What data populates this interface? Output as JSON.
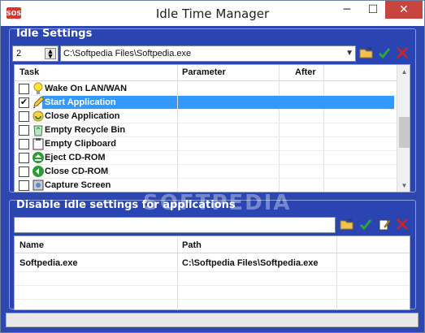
{
  "window": {
    "title": "Idle Time Manager",
    "min": "─",
    "max": "☐",
    "close": "✕"
  },
  "idle_settings": {
    "title": "Idle Settings",
    "spin_value": "2",
    "path_value": "C:\\Softpedia Files\\Softpedia.exe",
    "columns": [
      "Task",
      "Parameter",
      "After"
    ],
    "tasks": [
      {
        "label": "Wake On LAN/WAN",
        "checked": false,
        "icon": "lightbulb-icon",
        "selected": false
      },
      {
        "label": "Start Application",
        "checked": true,
        "icon": "pencil-icon",
        "selected": true
      },
      {
        "label": "Close Application",
        "checked": false,
        "icon": "close-app-icon",
        "selected": false
      },
      {
        "label": "Empty Recycle Bin",
        "checked": false,
        "icon": "recycle-bin-icon",
        "selected": false
      },
      {
        "label": "Empty Clipboard",
        "checked": false,
        "icon": "clipboard-icon",
        "selected": false
      },
      {
        "label": "Eject CD-ROM",
        "checked": false,
        "icon": "eject-icon",
        "selected": false
      },
      {
        "label": "Close CD-ROM",
        "checked": false,
        "icon": "close-cdrom-icon",
        "selected": false
      },
      {
        "label": "Capture Screen",
        "checked": false,
        "icon": "camera-icon",
        "selected": false
      }
    ]
  },
  "disable_settings": {
    "title": "Disable idle settings for applications",
    "input_value": "",
    "columns": [
      "Name",
      "Path"
    ],
    "rows": [
      {
        "name": "Softpedia.exe",
        "path": "C:\\Softpedia Files\\Softpedia.exe"
      }
    ]
  },
  "watermark": "SOFTPEDIA",
  "colors": {
    "accent": "#2d46b0",
    "selection": "#3399ff",
    "close": "#c7443f"
  }
}
